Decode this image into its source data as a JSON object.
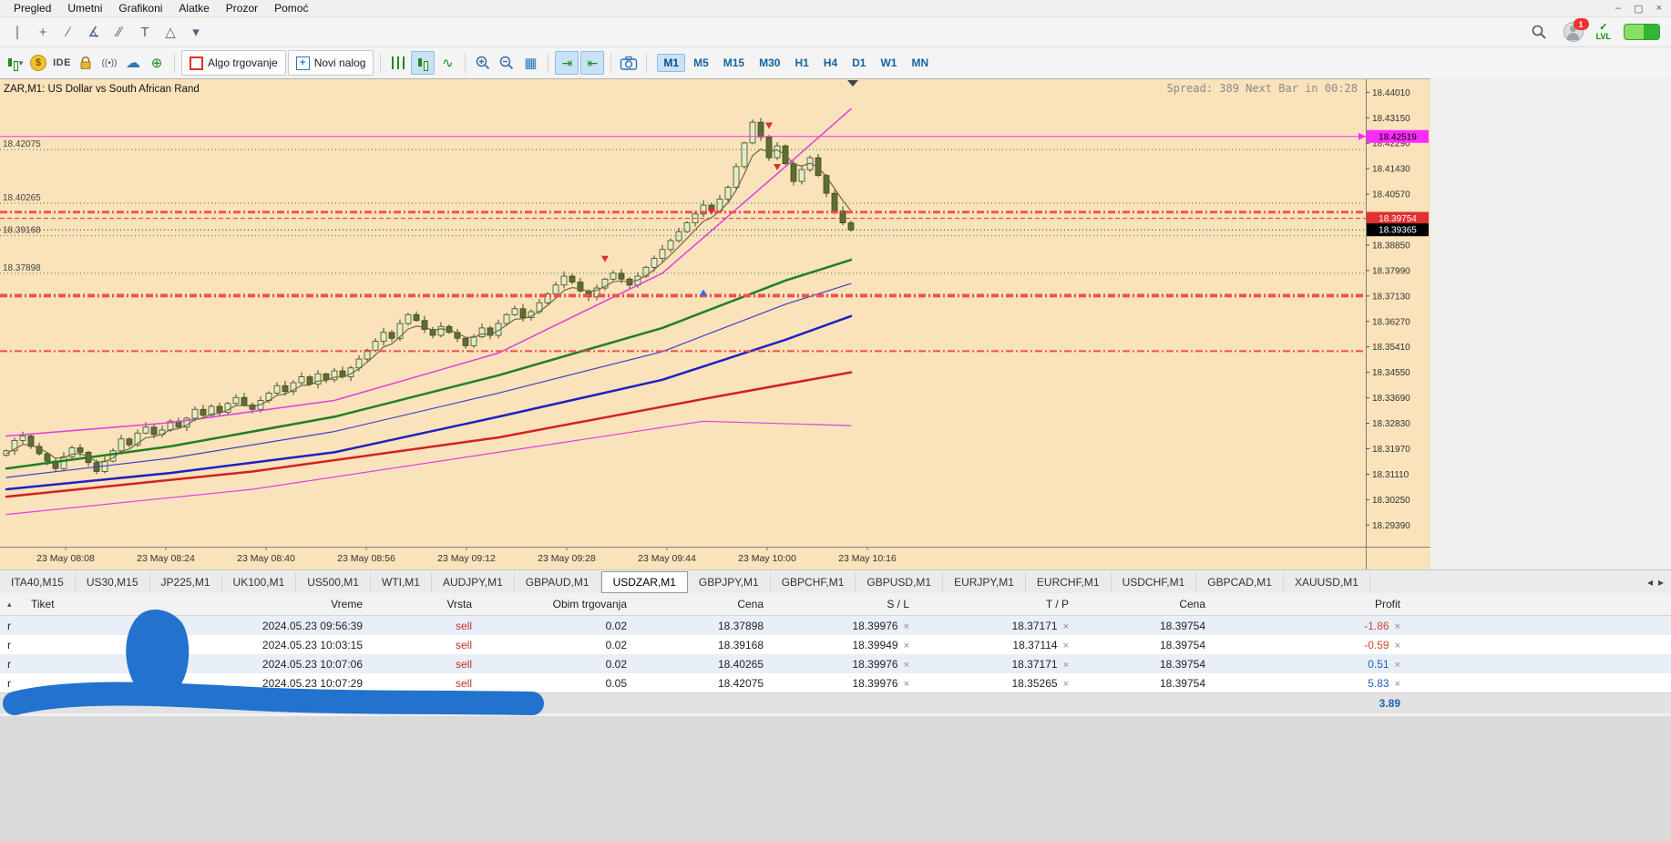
{
  "window": {
    "menu_items": [
      "Pregled",
      "Umetni",
      "Grafikoni",
      "Alatke",
      "Prozor",
      "Pomoć"
    ],
    "controls": {
      "minimize": "–",
      "maximize": "▢",
      "close": "×"
    }
  },
  "drawing_toolbar": {
    "tools": [
      {
        "name": "vertical-line-tool",
        "glyph": "∣"
      },
      {
        "name": "crosshair-tool",
        "glyph": "+"
      },
      {
        "name": "trendline-tool",
        "glyph": "∕"
      },
      {
        "name": "trend-angle-tool",
        "glyph": "∡"
      },
      {
        "name": "equidistant-channel-tool",
        "glyph": "∕∕"
      },
      {
        "name": "text-tool",
        "glyph": "T"
      },
      {
        "name": "shapes-tool",
        "glyph": "△"
      },
      {
        "name": "tools-dropdown",
        "glyph": "▾"
      }
    ],
    "status": {
      "notification_count": "1",
      "level_label": "LVL"
    }
  },
  "toolbar": {
    "ide_label": "IDE",
    "algo_label": "Algo trgovanje",
    "new_order_label": "Novi nalog",
    "timeframes": [
      "M1",
      "M5",
      "M15",
      "M30",
      "H1",
      "H4",
      "D1",
      "W1",
      "MN"
    ],
    "active_timeframe": "M1"
  },
  "chart": {
    "title": "ZAR,M1:  US Dollar vs South African Rand",
    "status_text": "Spread: 389  Next Bar in 00:28",
    "bg_color": "#FAE2BA",
    "time_labels": [
      "23 May 08:08",
      "23 May 08:24",
      "23 May 08:40",
      "23 May 08:56",
      "23 May 09:12",
      "23 May 09:28",
      "23 May 09:44",
      "23 May 10:00",
      "23 May 10:16"
    ],
    "axis_ticks": [
      "18.44010",
      "18.43150",
      "18.42290",
      "18.41430",
      "18.40570",
      "18.39710",
      "18.38850",
      "18.37990",
      "18.37130",
      "18.36270",
      "18.35410",
      "18.34550",
      "18.33690",
      "18.32830",
      "18.31970",
      "18.31110",
      "18.30250",
      "18.29390"
    ]
  },
  "chart_data": {
    "type": "candlestick",
    "symbol": "USDZAR",
    "timeframe": "M1",
    "price_top": 18.4442,
    "price_bottom": 18.2866,
    "first_open": 18.3175,
    "closes": [
      18.319,
      18.3225,
      18.324,
      18.3205,
      18.318,
      18.3155,
      18.313,
      18.317,
      18.32,
      18.3185,
      18.315,
      18.312,
      18.3155,
      18.319,
      18.323,
      18.321,
      18.325,
      18.327,
      18.3245,
      18.326,
      18.329,
      18.327,
      18.33,
      18.333,
      18.331,
      18.334,
      18.332,
      18.335,
      18.337,
      18.3345,
      18.333,
      18.336,
      18.3385,
      18.341,
      18.339,
      18.342,
      18.344,
      18.3415,
      18.345,
      18.343,
      18.346,
      18.344,
      18.347,
      18.35,
      18.353,
      18.356,
      18.359,
      18.357,
      18.362,
      18.365,
      18.363,
      18.36,
      18.358,
      18.361,
      18.359,
      18.357,
      18.3545,
      18.3575,
      18.3605,
      18.358,
      18.362,
      18.365,
      18.367,
      18.364,
      18.366,
      18.369,
      18.372,
      18.375,
      18.378,
      18.376,
      18.373,
      18.371,
      18.374,
      18.377,
      18.379,
      18.377,
      18.375,
      18.378,
      18.381,
      18.384,
      18.387,
      18.39,
      18.393,
      18.396,
      18.399,
      18.402,
      18.4,
      18.404,
      18.408,
      18.415,
      18.423,
      18.43,
      18.425,
      18.418,
      18.422,
      18.416,
      18.41,
      18.414,
      18.418,
      18.412,
      18.406,
      18.4,
      18.396,
      18.3936
    ],
    "overlays": [
      {
        "name": "envelope-upper",
        "color": "#E040E0",
        "width": 1.5,
        "points": [
          [
            0,
            18.324
          ],
          [
            20,
            18.3285
          ],
          [
            40,
            18.336
          ],
          [
            60,
            18.352
          ],
          [
            80,
            18.379
          ],
          [
            95,
            18.415
          ],
          [
            103,
            18.4345
          ]
        ]
      },
      {
        "name": "envelope-lower",
        "color": "#E040E0",
        "width": 1.2,
        "points": [
          [
            0,
            18.2975
          ],
          [
            30,
            18.306
          ],
          [
            60,
            18.3185
          ],
          [
            85,
            18.329
          ],
          [
            103,
            18.3275
          ]
        ]
      },
      {
        "name": "ma-red-slow",
        "color": "#D42020",
        "width": 2.5,
        "points": [
          [
            0,
            18.3035
          ],
          [
            30,
            18.312
          ],
          [
            60,
            18.3235
          ],
          [
            85,
            18.3365
          ],
          [
            103,
            18.3455
          ]
        ]
      },
      {
        "name": "ma-blue-slow",
        "color": "#2020C0",
        "width": 2.5,
        "points": [
          [
            0,
            18.306
          ],
          [
            20,
            18.3115
          ],
          [
            40,
            18.3185
          ],
          [
            60,
            18.3305
          ],
          [
            80,
            18.343
          ],
          [
            95,
            18.3565
          ],
          [
            103,
            18.3645
          ]
        ]
      },
      {
        "name": "ma-blue-mid",
        "color": "#4040C8",
        "width": 1.2,
        "points": [
          [
            0,
            18.31
          ],
          [
            20,
            18.3165
          ],
          [
            40,
            18.3255
          ],
          [
            60,
            18.3385
          ],
          [
            80,
            18.3525
          ],
          [
            95,
            18.3685
          ],
          [
            103,
            18.3755
          ]
        ]
      },
      {
        "name": "ma-green",
        "color": "#208020",
        "width": 2.5,
        "points": [
          [
            0,
            18.313
          ],
          [
            20,
            18.3205
          ],
          [
            40,
            18.3305
          ],
          [
            60,
            18.3445
          ],
          [
            80,
            18.3605
          ],
          [
            95,
            18.3765
          ],
          [
            103,
            18.3835
          ]
        ]
      }
    ],
    "hlines": [
      {
        "price": 18.42519,
        "style": "solid",
        "color": "#FF2BFF",
        "width": 1,
        "axis_label": "18.42519",
        "label_bg": "#FF2BFF",
        "label_fg": "#000000",
        "arrow": true
      },
      {
        "price": 18.42075,
        "style": "dotted",
        "color": "#2E8B2E",
        "width": 1,
        "left_label": "18.42075"
      },
      {
        "price": 18.40265,
        "style": "dotted",
        "color": "#2E8B2E",
        "width": 1,
        "left_label": "18.40265"
      },
      {
        "price": 18.39168,
        "style": "dotted",
        "color": "#2E8B2E",
        "width": 1,
        "left_label": "18.39168"
      },
      {
        "price": 18.37898,
        "style": "dotted",
        "color": "#2E8B2E",
        "width": 1,
        "left_label": "18.37898"
      },
      {
        "price": 18.39976,
        "style": "dashdot",
        "color": "#F05050",
        "width": 2
      },
      {
        "price": 18.39949,
        "style": "dashdot",
        "color": "#F05050",
        "width": 2
      },
      {
        "price": 18.37171,
        "style": "dashdot",
        "color": "#F05050",
        "width": 2
      },
      {
        "price": 18.37114,
        "style": "dashdot",
        "color": "#F05050",
        "width": 2
      },
      {
        "price": 18.35265,
        "style": "dashdot",
        "color": "#F05050",
        "width": 2
      },
      {
        "price": 18.39754,
        "style": "dashed",
        "color": "#E03030",
        "width": 1,
        "axis_label": "18.39754",
        "label_bg": "#E03030",
        "label_fg": "#FFFFFF"
      },
      {
        "price": 18.39365,
        "style": "dotted",
        "color": "#303030",
        "width": 1,
        "axis_label": "18.39365",
        "label_bg": "#000000",
        "label_fg": "#FFFFFF"
      }
    ],
    "markers": [
      {
        "bar": 73,
        "price": 18.3815,
        "dir": "down",
        "color": "#E03030"
      },
      {
        "bar": 85,
        "price": 18.3748,
        "dir": "up",
        "color": "#2E6BE0"
      },
      {
        "bar": 86,
        "price": 18.3975,
        "dir": "down",
        "color": "#E03030"
      },
      {
        "bar": 93,
        "price": 18.4265,
        "dir": "down",
        "color": "#E03030"
      },
      {
        "bar": 94,
        "price": 18.4125,
        "dir": "down",
        "color": "#E03030"
      }
    ]
  },
  "tabs": {
    "items": [
      "ITA40,M15",
      "US30,M15",
      "JP225,M1",
      "UK100,M1",
      "US500,M1",
      "WTI,M1",
      "AUDJPY,M1",
      "GBPAUD,M1",
      "USDZAR,M1",
      "GBPJPY,M1",
      "GBPCHF,M1",
      "GBPUSD,M1",
      "EURJPY,M1",
      "EURCHF,M1",
      "USDCHF,M1",
      "GBPCAD,M1",
      "XAUUSD,M1"
    ],
    "active": "USDZAR,M1",
    "nav_left": "◂",
    "nav_right": "▸"
  },
  "positions": {
    "sort_glyph": "▴",
    "close_glyph": "×",
    "columns": [
      "Tiket",
      "Vreme",
      "Vrsta",
      "Obim trgovanja",
      "Cena",
      "S / L",
      "T / P",
      "Cena",
      "Profit"
    ],
    "rows": [
      {
        "symbol": "r",
        "ticket": "",
        "time": "2024.05.23 09:56:39",
        "type": "sell",
        "volume": "0.02",
        "price": "18.37898",
        "sl": "18.39976",
        "tp": "18.37171",
        "current": "18.39754",
        "profit": "-1.86",
        "profit_sign": "neg"
      },
      {
        "symbol": "r",
        "ticket": "",
        "time": "2024.05.23 10:03:15",
        "type": "sell",
        "volume": "0.02",
        "price": "18.39168",
        "sl": "18.39949",
        "tp": "18.37114",
        "current": "18.39754",
        "profit": "-0.59",
        "profit_sign": "neg"
      },
      {
        "symbol": "r",
        "ticket": "",
        "time": "2024.05.23 10:07:06",
        "type": "sell",
        "volume": "0.02",
        "price": "18.40265",
        "sl": "18.39976",
        "tp": "18.37171",
        "current": "18.39754",
        "profit": "0.51",
        "profit_sign": "pos"
      },
      {
        "symbol": "r",
        "ticket": "",
        "time": "2024.05.23 10:07:29",
        "type": "sell",
        "volume": "0.05",
        "price": "18.42075",
        "sl": "18.39976",
        "tp": "18.35265",
        "current": "18.39754",
        "profit": "5.83",
        "profit_sign": "pos"
      }
    ],
    "total_profit": "3.89"
  },
  "colors": {
    "accent_blue": "#1464A0",
    "profit_neg": "#D0482A",
    "profit_pos": "#1E62B8",
    "scribble": "#2272CE",
    "sell_red": "#C03030"
  }
}
